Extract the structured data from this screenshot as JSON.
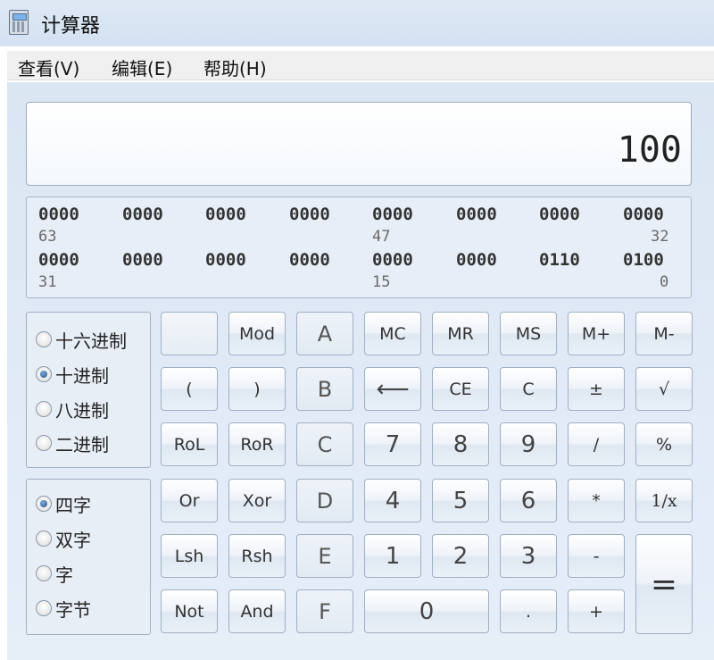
{
  "window": {
    "title": "计算器",
    "icon": "calculator-icon"
  },
  "menu": [
    "查看(V)",
    "编辑(E)",
    "帮助(H)"
  ],
  "display": {
    "value": "100"
  },
  "bits": {
    "row1": [
      "0000",
      "0000",
      "0000",
      "0000",
      "0000",
      "0000",
      "0000",
      "0000"
    ],
    "row1_positions": [
      "63",
      "47",
      "32"
    ],
    "row2": [
      "0000",
      "0000",
      "0000",
      "0000",
      "0000",
      "0000",
      "0110",
      "0100"
    ],
    "row2_positions": [
      "31",
      "15",
      "0"
    ]
  },
  "radix": {
    "options": [
      "十六进制",
      "十进制",
      "八进制",
      "二进制"
    ],
    "selected": "十进制"
  },
  "word_size": {
    "options": [
      "四字",
      "双字",
      "字",
      "字节"
    ],
    "selected": "四字"
  },
  "buttons": {
    "blank": "",
    "mod": "Mod",
    "a": "A",
    "mc": "MC",
    "mr": "MR",
    "ms": "MS",
    "m_plus": "M+",
    "m_minus": "M-",
    "lparen": "(",
    "rparen": ")",
    "b": "B",
    "backspace": "⟵",
    "ce": "CE",
    "c": "C",
    "plusminus": "±",
    "sqrt": "√",
    "rol": "RoL",
    "ror": "RoR",
    "hex_c": "C",
    "n7": "7",
    "n8": "8",
    "n9": "9",
    "divide": "/",
    "percent": "%",
    "or": "Or",
    "xor": "Xor",
    "d": "D",
    "n4": "4",
    "n5": "5",
    "n6": "6",
    "multiply": "*",
    "reciprocal": "1/x",
    "lsh": "Lsh",
    "rsh": "Rsh",
    "e": "E",
    "n1": "1",
    "n2": "2",
    "n3": "3",
    "minus": "-",
    "equals": "=",
    "not": "Not",
    "and": "And",
    "f": "F",
    "n0": "0",
    "dot": ".",
    "plus": "+"
  }
}
